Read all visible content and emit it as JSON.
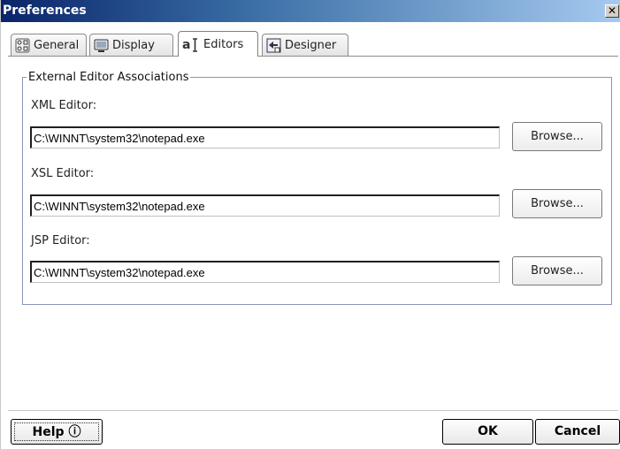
{
  "window": {
    "title": "Preferences",
    "close_symbol": "✕"
  },
  "tabs": [
    {
      "label": "General",
      "icon": "general-icon",
      "active": false
    },
    {
      "label": "Display",
      "icon": "display-icon",
      "active": false
    },
    {
      "label": "Editors",
      "icon": "editors-icon",
      "active": true
    },
    {
      "label": "Designer",
      "icon": "designer-icon",
      "active": false
    }
  ],
  "editors": {
    "group_title": "External Editor Associations",
    "fields": [
      {
        "label": "XML Editor:",
        "value": "C:\\WINNT\\system32\\notepad.exe",
        "browse": "Browse..."
      },
      {
        "label": "XSL Editor:",
        "value": "C:\\WINNT\\system32\\notepad.exe",
        "browse": "Browse..."
      },
      {
        "label": "JSP Editor:",
        "value": "C:\\WINNT\\system32\\notepad.exe",
        "browse": "Browse..."
      }
    ]
  },
  "buttons": {
    "help": "Help ⓘ",
    "ok": "OK",
    "cancel": "Cancel"
  }
}
